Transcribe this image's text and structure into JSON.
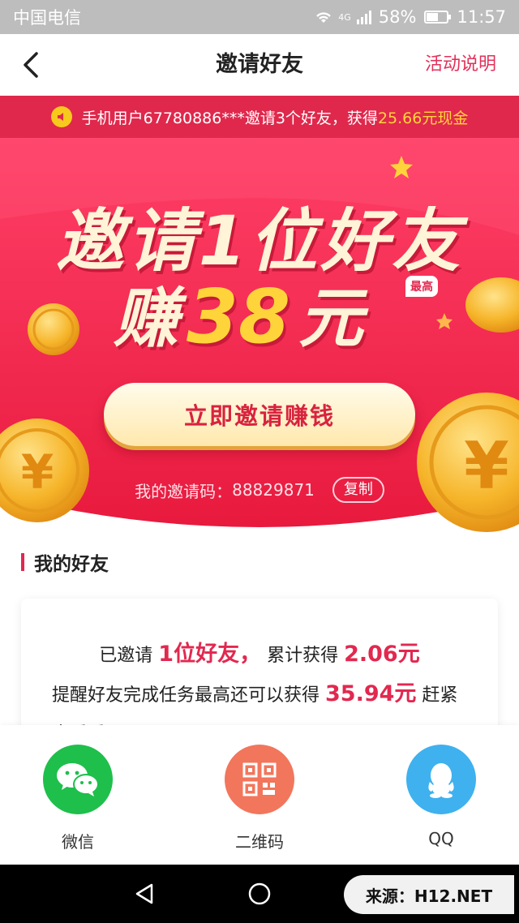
{
  "status_bar": {
    "carrier": "中国电信",
    "network": "4G",
    "battery": "58%",
    "battery_level": 0.58,
    "time": "11:57"
  },
  "nav": {
    "title": "邀请好友",
    "action": "活动说明"
  },
  "ticker": {
    "text_prefix": "手机用户67780886***邀请3个好友，获得",
    "highlight": "25.66元现金"
  },
  "hero": {
    "line1": "邀请1位好友",
    "earn_word": "赚",
    "amount": "38",
    "unit": "元",
    "badge": "最高",
    "button_label": "立即邀请赚钱",
    "code_label": "我的邀请码：",
    "code_value": "88829871",
    "copy_label": "复制"
  },
  "friends": {
    "section_title": "我的好友",
    "invited_prefix": "已邀请",
    "invited_count": "1位好友，",
    "earned_prefix": "累计获得",
    "earned_amount": "2.06元",
    "remind_text": "提醒好友完成任务最高还可以获得",
    "remind_amount": "35.94元",
    "remind_suffix": "赶紧去看看吧！"
  },
  "share": [
    {
      "label": "微信",
      "icon": "wechat-icon",
      "color": "#1fbf4c"
    },
    {
      "label": "二维码",
      "icon": "qrcode-icon",
      "color": "#f2765c"
    },
    {
      "label": "QQ",
      "icon": "qq-icon",
      "color": "#3fb1ee"
    }
  ],
  "watermark": "来源：H12.NET",
  "colors": {
    "accent": "#e2284f",
    "gold": "#ffd43a"
  }
}
